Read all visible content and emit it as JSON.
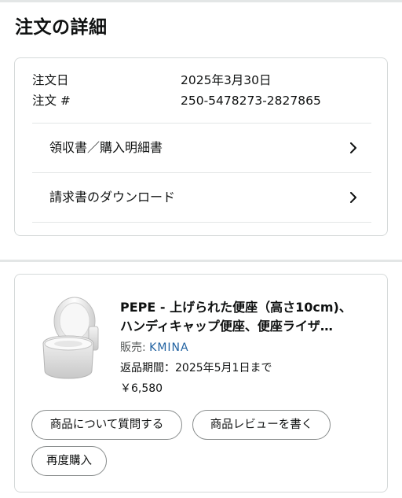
{
  "page": {
    "title": "注文の詳細"
  },
  "order": {
    "date_label": "注文日",
    "date_value": "2025年3月30日",
    "number_label": "注文 #",
    "number_value": "250-5478273-2827865"
  },
  "links": [
    {
      "label": "領収書／購入明細書",
      "icon": "chevron-right-icon"
    },
    {
      "label": "請求書のダウンロード",
      "icon": "chevron-right-icon"
    }
  ],
  "item": {
    "image": "raised-toilet-seat",
    "title_line1": "PEPE - 上げられた便座（高さ10cm)、",
    "title_line2": "ハンディキャップ便座、便座ライザ…",
    "seller_label": "販売: ",
    "seller_name": "KMINA",
    "return_period": "返品期間：2025年5月1日まで",
    "price": "￥6,580"
  },
  "actions": {
    "question_label": "商品について質問する",
    "review_label": "商品レビューを書く",
    "rebuy_label": "再度購入"
  },
  "colors": {
    "text": "#0f1111",
    "secondary_text": "#565959",
    "link": "#2162a1",
    "border": "#d5d9d9",
    "divider": "#e3e6e6"
  }
}
